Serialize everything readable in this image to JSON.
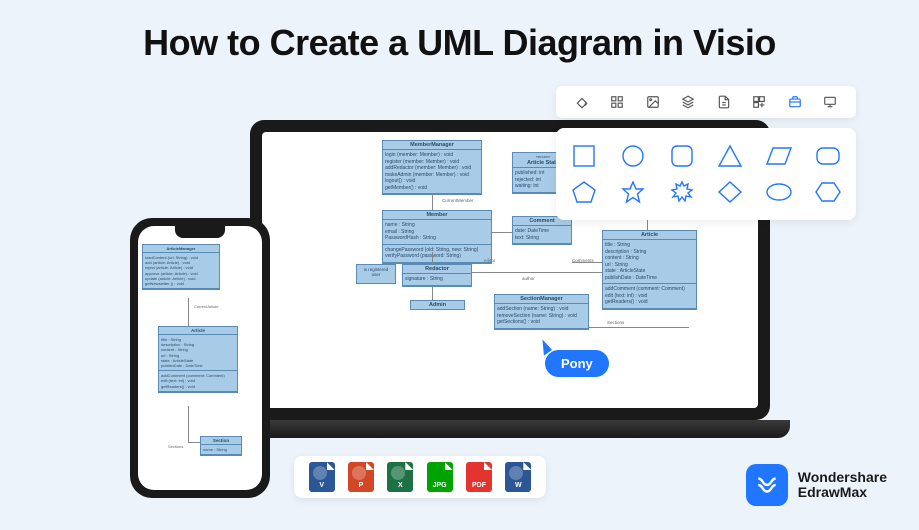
{
  "title": "How to Create a UML Diagram in Visio",
  "cursor_label": "Pony",
  "brand": {
    "line1": "Wondershare",
    "line2": "EdrawMax"
  },
  "toolbar": [
    {
      "name": "fill-icon"
    },
    {
      "name": "grid-icon"
    },
    {
      "name": "image-icon"
    },
    {
      "name": "layers-icon"
    },
    {
      "name": "page-icon"
    },
    {
      "name": "components-icon"
    },
    {
      "name": "library-icon",
      "active": true
    },
    {
      "name": "presentation-icon"
    }
  ],
  "shapes_row1": [
    "square",
    "circle",
    "rounded-square",
    "triangle",
    "parallelogram",
    "rounded-rect"
  ],
  "shapes_row2": [
    "pentagon",
    "star",
    "burst",
    "diamond",
    "ellipse",
    "hexagon"
  ],
  "exports": [
    {
      "label": "V",
      "color": "#2b5797",
      "name": "visio"
    },
    {
      "label": "P",
      "color": "#d24726",
      "name": "powerpoint"
    },
    {
      "label": "X",
      "color": "#1e7145",
      "name": "excel"
    },
    {
      "label": "JPG",
      "color": "#00a300",
      "name": "jpg"
    },
    {
      "label": "PDF",
      "color": "#e3342f",
      "name": "pdf"
    },
    {
      "label": "W",
      "color": "#2b5797",
      "name": "word"
    }
  ],
  "uml": {
    "memberManager": {
      "title": "MemberManager",
      "attrs": [
        "login (member: Member) : void",
        "register (member: Member) : void",
        "addRedactor (member: Member) : void",
        "makeAdmin (member: Member) : void",
        "logout() : void",
        "getMember() : void"
      ]
    },
    "articleState": {
      "stereo": "«enum»",
      "title": "Article State",
      "attrs": [
        "published: int",
        "rejected: int",
        "waiting: int"
      ]
    },
    "member": {
      "title": "Member",
      "attrs": [
        "name : String",
        "email : String",
        "PasswordHash : String"
      ],
      "ops": [
        "changePassword (old: String, new: String)",
        "verifyPassword (password: String)"
      ]
    },
    "comment": {
      "title": "Comment",
      "attrs": [
        "date: DateTime",
        "text: String"
      ]
    },
    "redactor": {
      "title": "Redactor",
      "attrs": [
        "signature : String"
      ]
    },
    "admin": {
      "title": "Admin"
    },
    "sectionManager": {
      "title": "SectionManager",
      "attrs": [
        "addSection (name: String) : void",
        "removeSection (name: String) : void",
        "getSections() : void"
      ]
    },
    "article": {
      "title": "Article",
      "attrs": [
        "title : String",
        "description : String",
        "content : String",
        "url : String",
        "state : ArticleState",
        "publishDate : DateTime"
      ],
      "ops": [
        "addComment (comment: Comment)",
        "edit (text: int) : void",
        "getReaders() : void"
      ]
    },
    "section": {
      "title": "Section",
      "attrs": [
        "name : String"
      ]
    },
    "articleManager": {
      "title": "ArticleManager",
      "attrs": [
        "loadContent (url: String) : void",
        "add (article: Article) : void",
        "reject (article: Article) : void",
        "approve (article: Article) : void",
        "update (article: Article) : void",
        "getNewsletter () : void"
      ]
    },
    "labels": {
      "currentMember": "CurrentMember",
      "currentArticle": "CurrentArticle",
      "isRegistered": "is registered user",
      "editor": "editor",
      "author": "author",
      "comments": "Comments",
      "sections": "Sections"
    }
  }
}
